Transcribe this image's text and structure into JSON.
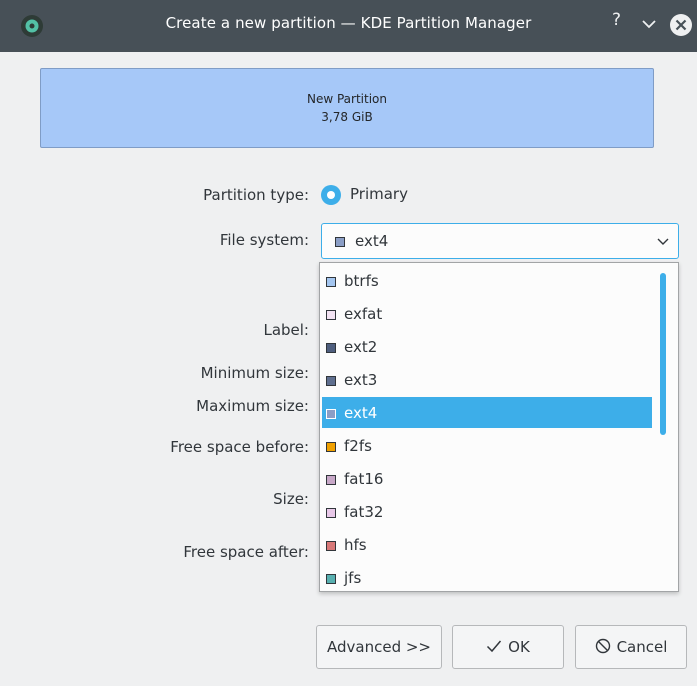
{
  "window": {
    "title": "Create a new partition — KDE Partition Manager",
    "help_glyph": "?"
  },
  "preview": {
    "name": "New Partition",
    "size": "3,78 GiB",
    "color": "#a6c8f8"
  },
  "form": {
    "partition_type_label": "Partition type:",
    "partition_type_value": "Primary",
    "file_system_label": "File system:",
    "label_label": "Label:",
    "min_size_label": "Minimum size:",
    "max_size_label": "Maximum size:",
    "free_before_label": "Free space before:",
    "size_label": "Size:",
    "free_after_label": "Free space after:"
  },
  "file_system": {
    "selected": "ext4",
    "selected_color": "#8b9ec6",
    "options": [
      {
        "name": "btrfs",
        "color": "#a4c6f0"
      },
      {
        "name": "exfat",
        "color": "#f3e3f3"
      },
      {
        "name": "ext2",
        "color": "#4e5e7e"
      },
      {
        "name": "ext3",
        "color": "#5f6f8f"
      },
      {
        "name": "ext4",
        "color": "#8b9ec6",
        "selected": true
      },
      {
        "name": "f2fs",
        "color": "#f0a000"
      },
      {
        "name": "fat16",
        "color": "#c8a8c8"
      },
      {
        "name": "fat32",
        "color": "#e8c8e8"
      },
      {
        "name": "hfs",
        "color": "#d87878"
      },
      {
        "name": "jfs",
        "color": "#58b0b0"
      }
    ]
  },
  "buttons": {
    "advanced": "Advanced >>",
    "ok": "OK",
    "cancel": "Cancel"
  },
  "colors": {
    "accent": "#3daee9",
    "titlebar": "#475057",
    "background": "#eff0f1"
  }
}
